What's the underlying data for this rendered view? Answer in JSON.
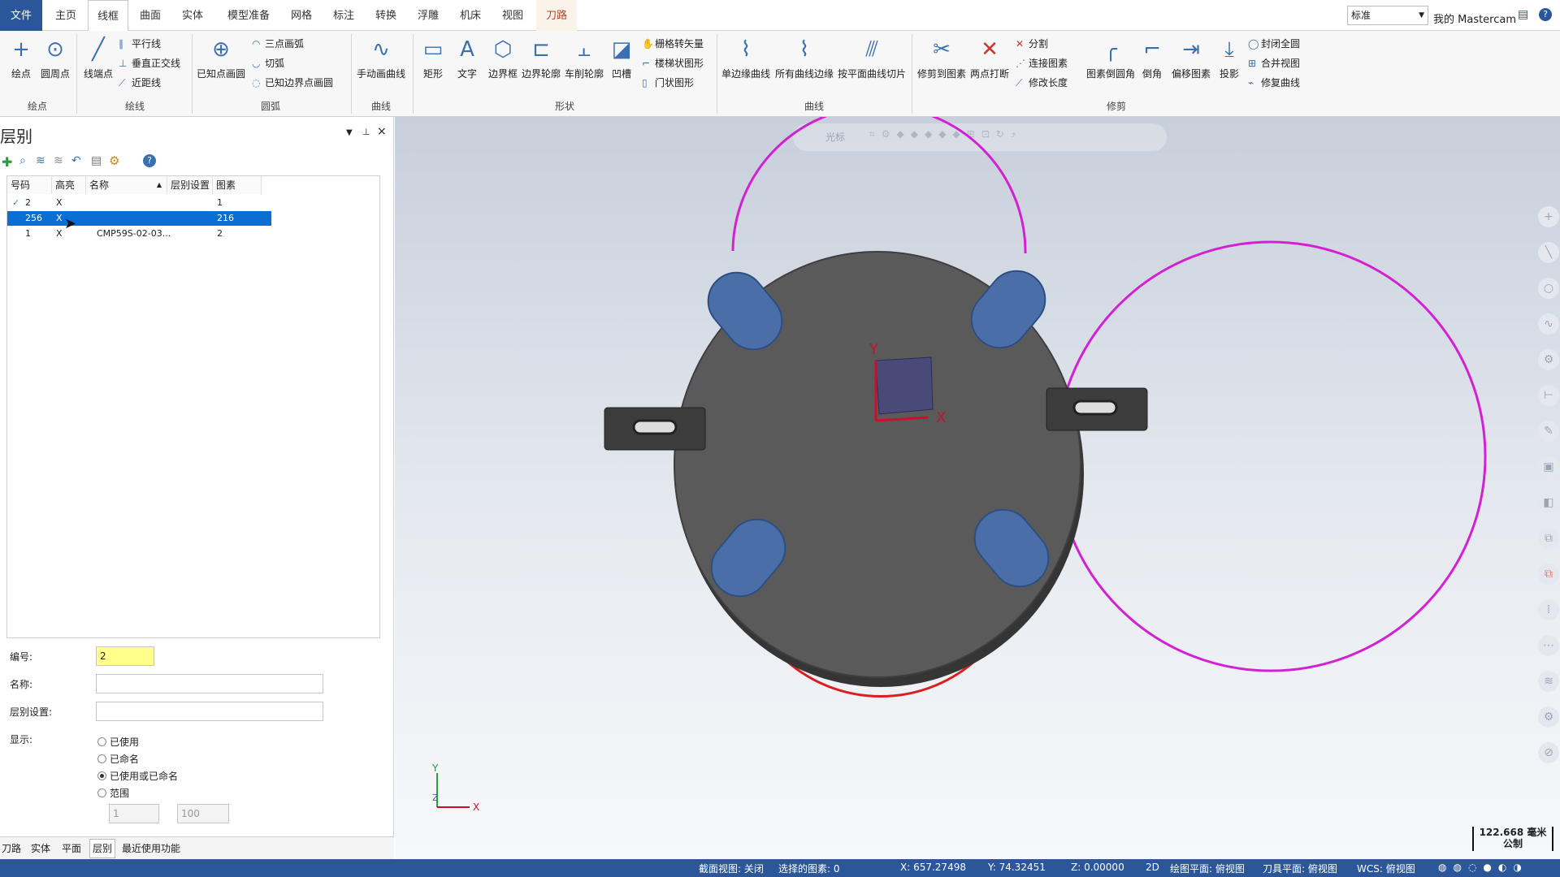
{
  "tabs": [
    "文件",
    "主页",
    "线框",
    "曲面",
    "实体",
    "模型准备",
    "网格",
    "标注",
    "转换",
    "浮雕",
    "机床",
    "视图",
    "刀路"
  ],
  "topright": {
    "style_value": "标准",
    "my_mastercam": "我的 Mastercam"
  },
  "ribbon": {
    "groups": [
      "绘点",
      "绘线",
      "圆弧",
      "曲线",
      "形状",
      "曲线",
      "修剪"
    ],
    "buttons": {
      "point": "绘点",
      "circle_point": "圆周点",
      "endpoint_line": "线端点",
      "known_point_circle": "已知点画圆",
      "manual_curve": "手动画曲线",
      "rect": "矩形",
      "text": "文字",
      "bbox": "边界框",
      "boundary_profile": "边界轮廓",
      "lathe_profile": "车削轮廓",
      "groove": "凹槽",
      "single_edge_curve": "单边缘曲线",
      "all_edges_curve": "所有曲线边缘",
      "plane_slice": "按平面曲线切片",
      "trim_to_entity": "修剪到图素",
      "two_point_break": "两点打断",
      "fillet_entity": "图素倒圆角",
      "chamfer": "倒角",
      "offset_entity": "偏移图素",
      "project": "投影"
    },
    "small": {
      "parallel": "平行线",
      "perp": "垂直正交线",
      "closest": "近距线",
      "three_point_arc": "三点画弧",
      "tangent_arc": "切弧",
      "known_boundary_circle": "已知边界点画圆",
      "raster_to_vector": "栅格转矢量",
      "stair_shape": "楼梯状图形",
      "door_shape": "门状图形",
      "divide": "分割",
      "join": "连接图素",
      "modify_length": "修改长度",
      "close_all": "封闭全圆",
      "merge_view": "合并视图",
      "repair_curve": "修复曲线"
    }
  },
  "levels_panel": {
    "title": "层别",
    "columns": [
      "号码",
      "高亮",
      "名称",
      "层别设置",
      "图素"
    ],
    "rows": [
      {
        "num": "2",
        "highlight": "X",
        "name": "",
        "setting": "",
        "count": "1",
        "current": true,
        "selected": false
      },
      {
        "num": "256",
        "highlight": "X",
        "name": "",
        "setting": "",
        "count": "216",
        "current": false,
        "selected": true
      },
      {
        "num": "1",
        "highlight": "X",
        "name": "CMP59S-02-03...",
        "setting": "",
        "count": "2",
        "current": false,
        "selected": false
      }
    ],
    "form": {
      "num_label": "编号:",
      "num_value": "2",
      "name_label": "名称:",
      "name_value": "",
      "setting_label": "层别设置:",
      "setting_value": "",
      "display_label": "显示:"
    },
    "radios": [
      {
        "label": "已使用",
        "checked": false
      },
      {
        "label": "已命名",
        "checked": false
      },
      {
        "label": "已使用或已命名",
        "checked": true
      },
      {
        "label": "范围",
        "checked": false
      }
    ],
    "range": {
      "from_placeholder": "1",
      "to_placeholder": "100"
    },
    "bottom_tabs": [
      "刀路",
      "实体",
      "平面",
      "层别",
      "最近使用功能"
    ]
  },
  "viewport": {
    "toolbar_label": "光标",
    "y_label": "Y",
    "x_label": "X",
    "z_label": "Z",
    "scale_value": "122.668 毫米",
    "scale_unit": "公制"
  },
  "status": {
    "section_view": "截面视图: 关闭",
    "selected": "选择的图素: 0",
    "x": "X:  657.27498",
    "y": "Y:  74.32451",
    "z": "Z:  0.00000",
    "mode": "2D",
    "draw_plane": "绘图平面: 俯视图",
    "tool_plane": "刀具平面: 俯视图",
    "wcs": "WCS: 俯视图"
  }
}
